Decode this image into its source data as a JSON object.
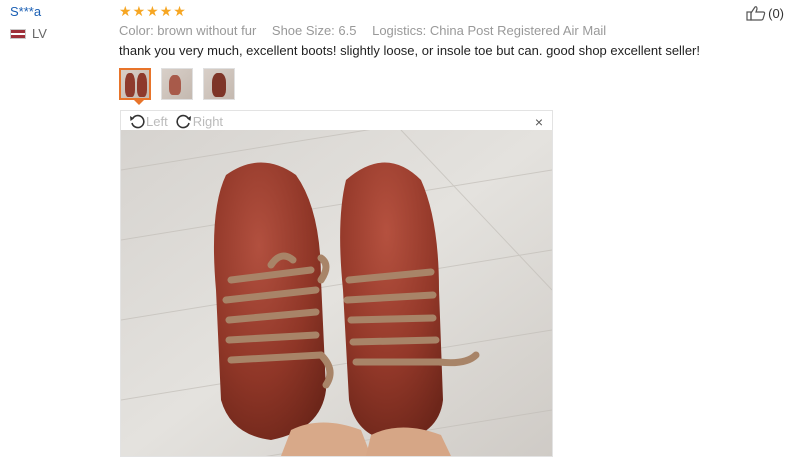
{
  "review": {
    "user_name": "S***a",
    "country_code": "LV",
    "rating_stars": [
      "★",
      "★",
      "★",
      "★",
      "★"
    ],
    "like_count": "(0)",
    "attributes": {
      "color": "Color: brown without fur",
      "shoe_size": "Shoe Size: 6.5",
      "logistics": "Logistics: China Post Registered Air Mail"
    },
    "comment": "thank you very much, excellent boots! slightly loose, or insole toe but can. good shop excellent seller!"
  },
  "viewer": {
    "rotate_left_label": "Left",
    "rotate_right_label": "Right",
    "close_glyph": "×"
  },
  "colors": {
    "star": "#f6a623",
    "username_link": "#1a5fb4",
    "active_thumb_border": "#e8742a"
  }
}
